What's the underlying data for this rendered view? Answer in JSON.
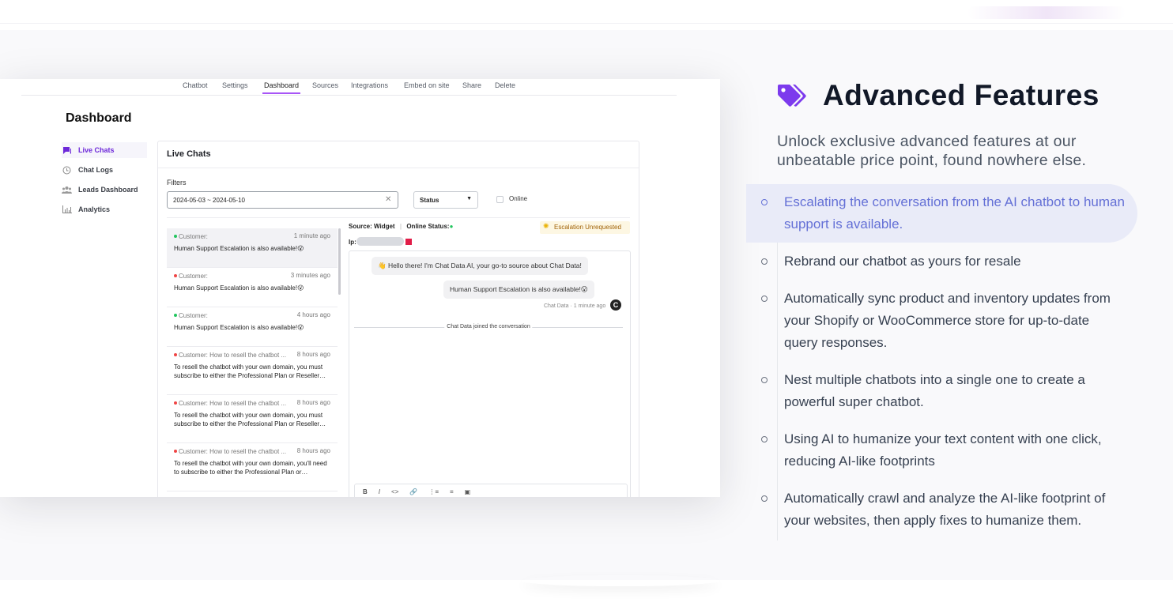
{
  "nav": {
    "tabs": [
      "Chatbot",
      "Settings",
      "Dashboard",
      "Sources",
      "Integrations",
      "Embed on site",
      "Share",
      "Delete"
    ],
    "active_tab": "Dashboard"
  },
  "dashboard": {
    "title": "Dashboard",
    "sidebar": [
      {
        "label": "Live Chats",
        "icon": "chat-icon",
        "active": true
      },
      {
        "label": "Chat Logs",
        "icon": "history-icon",
        "active": false
      },
      {
        "label": "Leads Dashboard",
        "icon": "users-icon",
        "active": false
      },
      {
        "label": "Analytics",
        "icon": "chart-icon",
        "active": false
      }
    ],
    "panel_title": "Live Chats",
    "filters_label": "Filters",
    "date_range": "2024-05-03 ~ 2024-05-10",
    "status_placeholder": "Status",
    "online_label": "Online",
    "conversations": [
      {
        "who": "Customer:",
        "time": "1 minute ago",
        "message": "Human Support Escalation is also available!😮",
        "status_color": "#22c55e"
      },
      {
        "who": "Customer:",
        "time": "3 minutes ago",
        "message": "Human Support Escalation is also available!😮",
        "status_color": "#ef4444"
      },
      {
        "who": "Customer:",
        "time": "4 hours ago",
        "message": "Human Support Escalation is also available!😮",
        "status_color": "#22c55e"
      },
      {
        "who": "Customer: How to resell the chatbot ...",
        "time": "8 hours ago",
        "message": "To resell the chatbot with your own domain, you must subscribe to either the Professional Plan or Reseller…",
        "status_color": "#ef4444"
      },
      {
        "who": "Customer: How to resell the chatbot ...",
        "time": "8 hours ago",
        "message": "To resell the chatbot with your own domain, you must subscribe to either the Professional Plan or Reseller…",
        "status_color": "#ef4444"
      },
      {
        "who": "Customer: How to resell the chatbot ...",
        "time": "8 hours ago",
        "message": "To resell the chatbot with your own domain, you'll need to subscribe to either the Professional Plan or…",
        "status_color": "#ef4444"
      }
    ],
    "chat": {
      "source": "Source: Widget",
      "online_status": "Online Status:",
      "escalation": "Escalation Unrequested",
      "ip_label": "Ip:",
      "bubble_1": "👋 Hello there! I'm Chat Data AI, your go-to source about Chat Data!",
      "bubble_2": "Human Support Escalation is also available!😮",
      "meta": "Chat Data · 1 minute ago",
      "avatar_letter": "C",
      "joined": "Chat Data joined the conversation",
      "toolbar": [
        "B",
        "I",
        "<>",
        "🔗",
        "⋮≡",
        "≡",
        "▣"
      ]
    }
  },
  "features": {
    "title": "Advanced Features",
    "subtitle": "Unlock exclusive advanced features at our unbeatable price point, found nowhere else.",
    "items": [
      "Escalating the conversation from the AI chatbot to human support is available.",
      "Rebrand our chatbot as yours for resale",
      "Automatically sync product and inventory updates from your Shopify or WooCommerce store for up-to-date query responses.",
      "Nest multiple chatbots into a single one to create a powerful super chatbot.",
      "Using AI to humanize your text content with one click, reducing AI-like footprints",
      "Automatically crawl and analyze the AI-like footprint of your websites, then apply fixes to humanize them."
    ],
    "accent_color": "#7c3aed"
  }
}
